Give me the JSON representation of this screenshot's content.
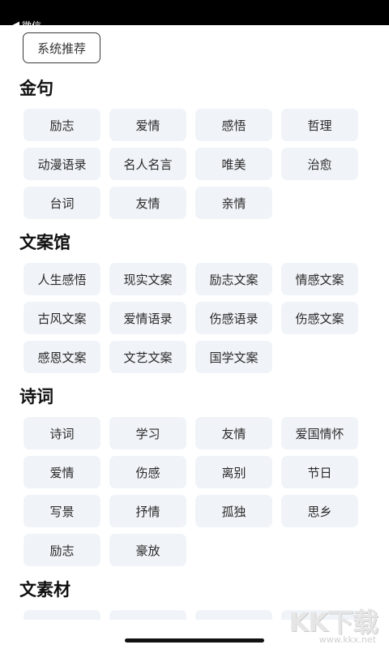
{
  "topbar": {
    "back_label": "微信"
  },
  "recommend_button": "系统推荐",
  "sections": [
    {
      "title": "金句",
      "tags": [
        "励志",
        "爱情",
        "感悟",
        "哲理",
        "动漫语录",
        "名人名言",
        "唯美",
        "治愈",
        "台词",
        "友情",
        "亲情"
      ]
    },
    {
      "title": "文案馆",
      "tags": [
        "人生感悟",
        "现实文案",
        "励志文案",
        "情感文案",
        "古风文案",
        "爱情语录",
        "伤感语录",
        "伤感文案",
        "感恩文案",
        "文艺文案",
        "国学文案"
      ]
    },
    {
      "title": "诗词",
      "tags": [
        "诗词",
        "学习",
        "友情",
        "爱国情怀",
        "爱情",
        "伤感",
        "离别",
        "节日",
        "写景",
        "抒情",
        "孤独",
        "思乡",
        "励志",
        "豪放"
      ]
    },
    {
      "title": "文素材",
      "tags": []
    }
  ],
  "watermark": {
    "mark": "KK下载",
    "url": "www.kkx.net"
  },
  "colors": {
    "tag_bg": "#f0f4f8",
    "topbar_bg": "#000000"
  }
}
